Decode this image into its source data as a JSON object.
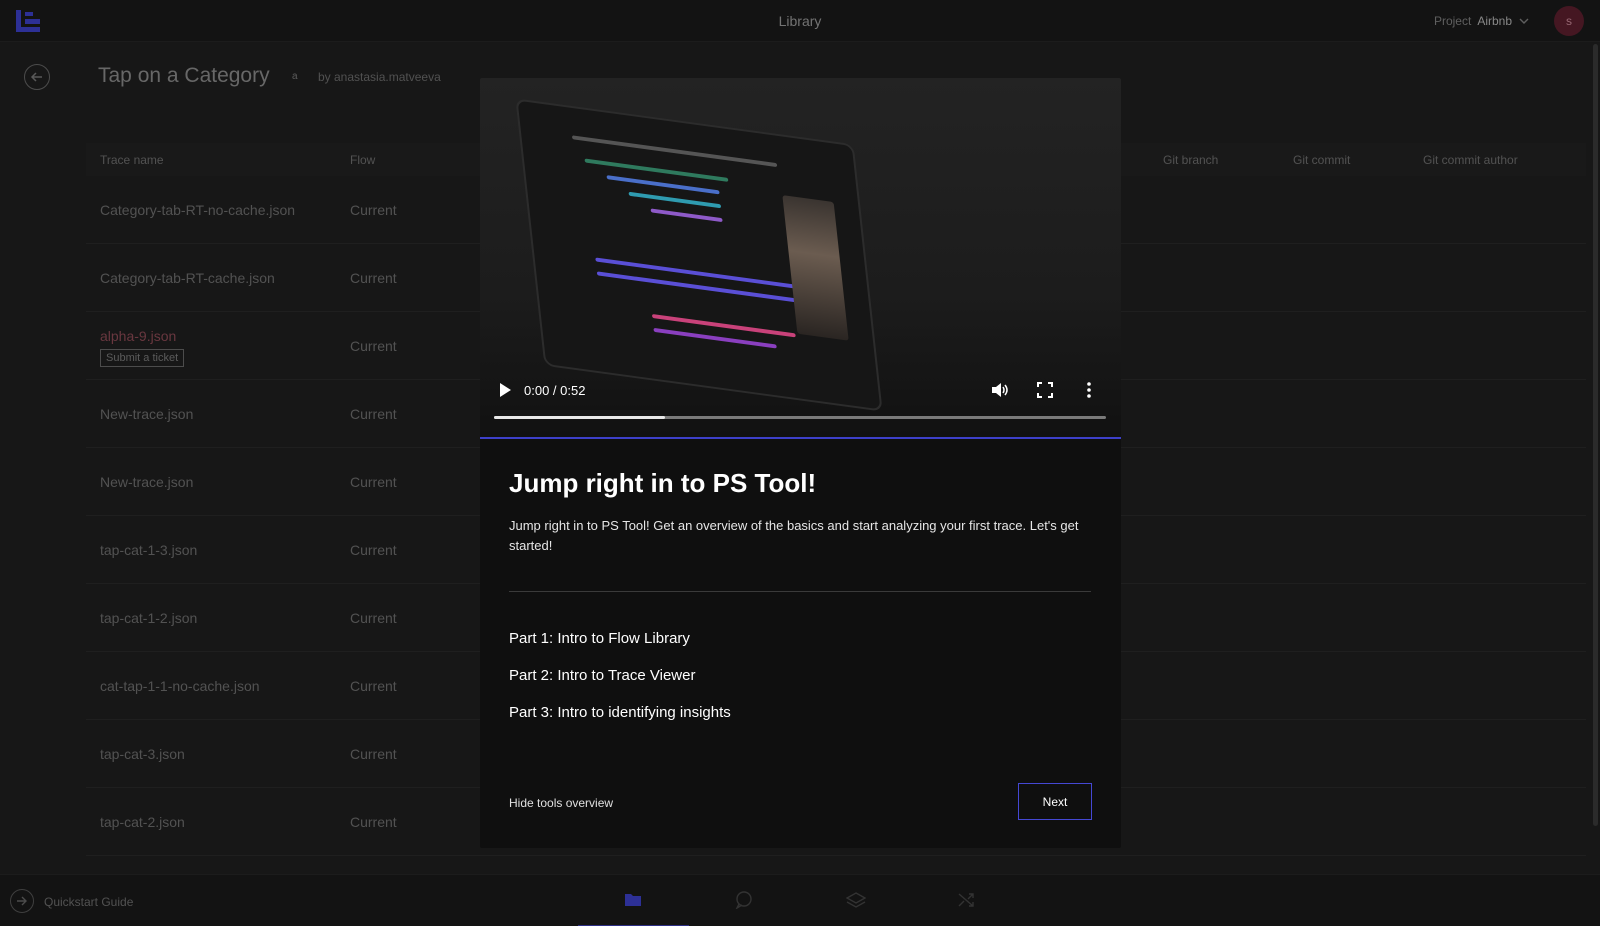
{
  "topbar": {
    "title": "Library",
    "project_label": "Project",
    "project_value": "Airbnb",
    "avatar_initial": "s"
  },
  "page": {
    "title": "Tap on a Category",
    "badge": "a",
    "author": "by anastasia.matveeva"
  },
  "table": {
    "columns": {
      "trace_name": "Trace name",
      "flow": "Flow",
      "git_branch": "Git branch",
      "git_commit": "Git commit",
      "git_commit_author": "Git commit author"
    },
    "rows": [
      {
        "name": "Category-tab-RT-no-cache.json",
        "flow": "Current"
      },
      {
        "name": "Category-tab-RT-cache.json",
        "flow": "Current"
      },
      {
        "name": "alpha-9.json",
        "flow": "Current",
        "action": "Submit a ticket"
      },
      {
        "name": "New-trace.json",
        "flow": "Current"
      },
      {
        "name": "New-trace.json",
        "flow": "Current"
      },
      {
        "name": "tap-cat-1-3.json",
        "flow": "Current"
      },
      {
        "name": "tap-cat-1-2.json",
        "flow": "Current"
      },
      {
        "name": "cat-tap-1-1-no-cache.json",
        "flow": "Current"
      },
      {
        "name": "tap-cat-3.json",
        "flow": "Current"
      },
      {
        "name": "tap-cat-2.json",
        "flow": "Current"
      }
    ]
  },
  "bottombar": {
    "quickstart_label": "Quickstart Guide",
    "icons": [
      "folder-icon",
      "chat-icon",
      "layers-icon",
      "shuffle-icon"
    ]
  },
  "modal": {
    "video": {
      "time": "0:00 / 0:52",
      "progress": 0.28
    },
    "heading": "Jump right in to PS Tool!",
    "description": "Jump right in to PS Tool! Get an overview of the basics and start analyzing your first trace. Let's get started!",
    "parts": [
      "Part 1: Intro to Flow Library",
      "Part 2: Intro to Trace Viewer",
      "Part 3: Intro to identifying insights"
    ],
    "hide_label": "Hide tools overview",
    "next_label": "Next"
  },
  "colors": {
    "accent": "#4548d4",
    "avatar_bg": "#5c1f2e",
    "error_text": "#8c4a55"
  }
}
